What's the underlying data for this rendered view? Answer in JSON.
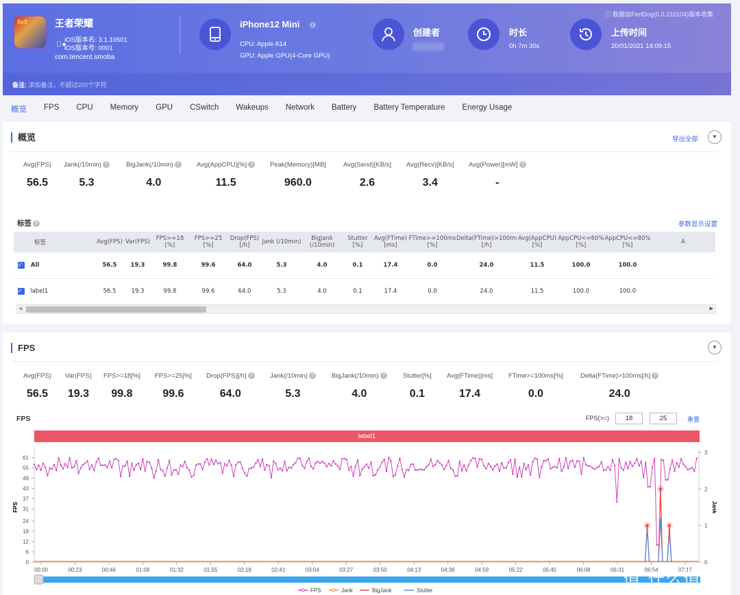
{
  "header": {
    "app_name": "王者荣耀",
    "app_icon_text": "5v5",
    "ios_version_name": "iOS版本名: 3.1.10501",
    "ios_version_code": "iOS版本号: 0001",
    "package": "com.tencent.smoba",
    "device_name": "iPhone12 Mini",
    "cpu": "CPU: Apple A14",
    "gpu": "GPU: Apple GPU(4-Core GPU)",
    "creator_label": "创建者",
    "duration_label": "时长",
    "duration_value": "0h 7m 30s",
    "upload_label": "上传时间",
    "upload_value": "20/01/2021 14:09:15",
    "perfdog_note": "ⓘ 数据由PerfDog(5.0.210104)版本收集",
    "remark_label": "备注:",
    "remark_placeholder": "添加备注，不超过200个字符"
  },
  "tabs": [
    "概览",
    "FPS",
    "CPU",
    "Memory",
    "GPU",
    "CSwitch",
    "Wakeups",
    "Network",
    "Battery",
    "Battery Temperature",
    "Energy Usage"
  ],
  "overview": {
    "title": "概览",
    "export_label": "导出全部",
    "metrics": [
      {
        "label": "Avg(FPS)",
        "value": "56.5",
        "help": false
      },
      {
        "label": "Jank(/10min)",
        "value": "5.3",
        "help": true
      },
      {
        "label": "BigJank(/10min)",
        "value": "4.0",
        "help": true
      },
      {
        "label": "Avg(AppCPU)[%]",
        "value": "11.5",
        "help": true
      },
      {
        "label": "Peak(Memory)[MB]",
        "value": "960.0",
        "help": false
      },
      {
        "label": "Avg(Send)[KB/s]",
        "value": "2.6",
        "help": false
      },
      {
        "label": "Avg(Recv)[KB/s]",
        "value": "3.4",
        "help": false
      },
      {
        "label": "Avg(Power)[mW]",
        "value": "-",
        "help": true
      }
    ],
    "tags_title": "标签",
    "param_settings": "参数显示设置",
    "table": {
      "headers": [
        "标签",
        "Avg(FPS)",
        "Var(FPS)",
        "FPS>=18 [%]",
        "FPS>=25 [%]",
        "Drop(FPS) [/h]",
        "Jank (/10min)",
        "BigJank (/10min)",
        "Stutter [%]",
        "Avg(FTime) [ms]",
        "FTime>=100ms [%]",
        "Delta(FTime)>100ms [/h]",
        "Avg(AppCPU) [%]",
        "AppCPU<=60% [%]",
        "AppCPU<=80% [%]",
        "A"
      ],
      "rows": [
        {
          "checked": true,
          "bold": true,
          "cells": [
            "All",
            "56.5",
            "19.3",
            "99.8",
            "99.6",
            "64.0",
            "5.3",
            "4.0",
            "0.1",
            "17.4",
            "0.0",
            "24.0",
            "11.5",
            "100.0",
            "100.0",
            ""
          ]
        },
        {
          "checked": true,
          "bold": false,
          "cells": [
            "label1",
            "56.5",
            "19.3",
            "99.8",
            "99.6",
            "64.0",
            "5.3",
            "4.0",
            "0.1",
            "17.4",
            "0.0",
            "24.0",
            "11.5",
            "100.0",
            "100.0",
            ""
          ]
        }
      ]
    }
  },
  "fps_section": {
    "title": "FPS",
    "metrics": [
      {
        "label": "Avg(FPS)",
        "value": "56.5",
        "help": false
      },
      {
        "label": "Var(FPS)",
        "value": "19.3",
        "help": false
      },
      {
        "label": "FPS>=18[%]",
        "value": "99.8",
        "help": false
      },
      {
        "label": "FPS>=25[%]",
        "value": "99.6",
        "help": false
      },
      {
        "label": "Drop(FPS)[/h]",
        "value": "64.0",
        "help": true
      },
      {
        "label": "Jank(/10min)",
        "value": "5.3",
        "help": true
      },
      {
        "label": "BigJank(/10min)",
        "value": "4.0",
        "help": true
      },
      {
        "label": "Stutter[%]",
        "value": "0.1",
        "help": false
      },
      {
        "label": "Avg(FTime)[ms]",
        "value": "17.4",
        "help": false
      },
      {
        "label": "FTime>=100ms[%]",
        "value": "0.0",
        "help": false
      },
      {
        "label": "Delta(FTime)>100ms[/h]",
        "value": "24.0",
        "help": true
      }
    ],
    "chart_label": "FPS",
    "fps_threshold_label": "FPS(>=)",
    "fps_threshold_1": "18",
    "fps_threshold_2": "25",
    "reset_label": "重置",
    "label_bar": "label1"
  },
  "chart_data": {
    "type": "line",
    "title": "FPS",
    "xlabel": "",
    "ylabel": "FPS",
    "y2label": "Jank",
    "ylim": [
      0,
      64
    ],
    "y2lim": [
      0,
      3
    ],
    "y_ticks": [
      0,
      6,
      12,
      18,
      24,
      31,
      37,
      43,
      49,
      55,
      61
    ],
    "y2_ticks": [
      0,
      1,
      2,
      3
    ],
    "x_ticks": [
      "00:00",
      "00:23",
      "00:46",
      "01:09",
      "01:32",
      "01:55",
      "02:18",
      "02:41",
      "03:04",
      "03:27",
      "03:50",
      "04:13",
      "04:36",
      "04:59",
      "05:22",
      "05:45",
      "06:08",
      "06:31",
      "06:54",
      "07:17"
    ],
    "duration_seconds": 450,
    "legend": [
      "FPS",
      "Jank",
      "BigJank",
      "Stutter"
    ],
    "legend_position": "bottom-right",
    "colors": {
      "FPS": "#cc44c0",
      "Jank": "#f08a4b",
      "BigJank": "#e84848",
      "Stutter": "#5b8ee8"
    },
    "series": [
      {
        "name": "FPS",
        "note": "~300 samples oscillating 49-61, mean 56.5; dips to ~35 near 06:35, ~44 near 06:55, ~43 near 07:02"
      },
      {
        "name": "Jank",
        "points": [
          {
            "t": 415,
            "v": 1
          },
          {
            "t": 424,
            "v": 2
          },
          {
            "t": 430,
            "v": 1
          }
        ]
      },
      {
        "name": "BigJank",
        "points": [
          {
            "t": 415,
            "v": 1
          },
          {
            "t": 424,
            "v": 2
          },
          {
            "t": 430,
            "v": 1
          }
        ]
      },
      {
        "name": "Stutter",
        "points": [
          {
            "t": 415,
            "v": 0.9
          },
          {
            "t": 424,
            "v": 1.2
          },
          {
            "t": 430,
            "v": 0.8
          }
        ]
      }
    ]
  },
  "watermark": "值 什么值得买"
}
